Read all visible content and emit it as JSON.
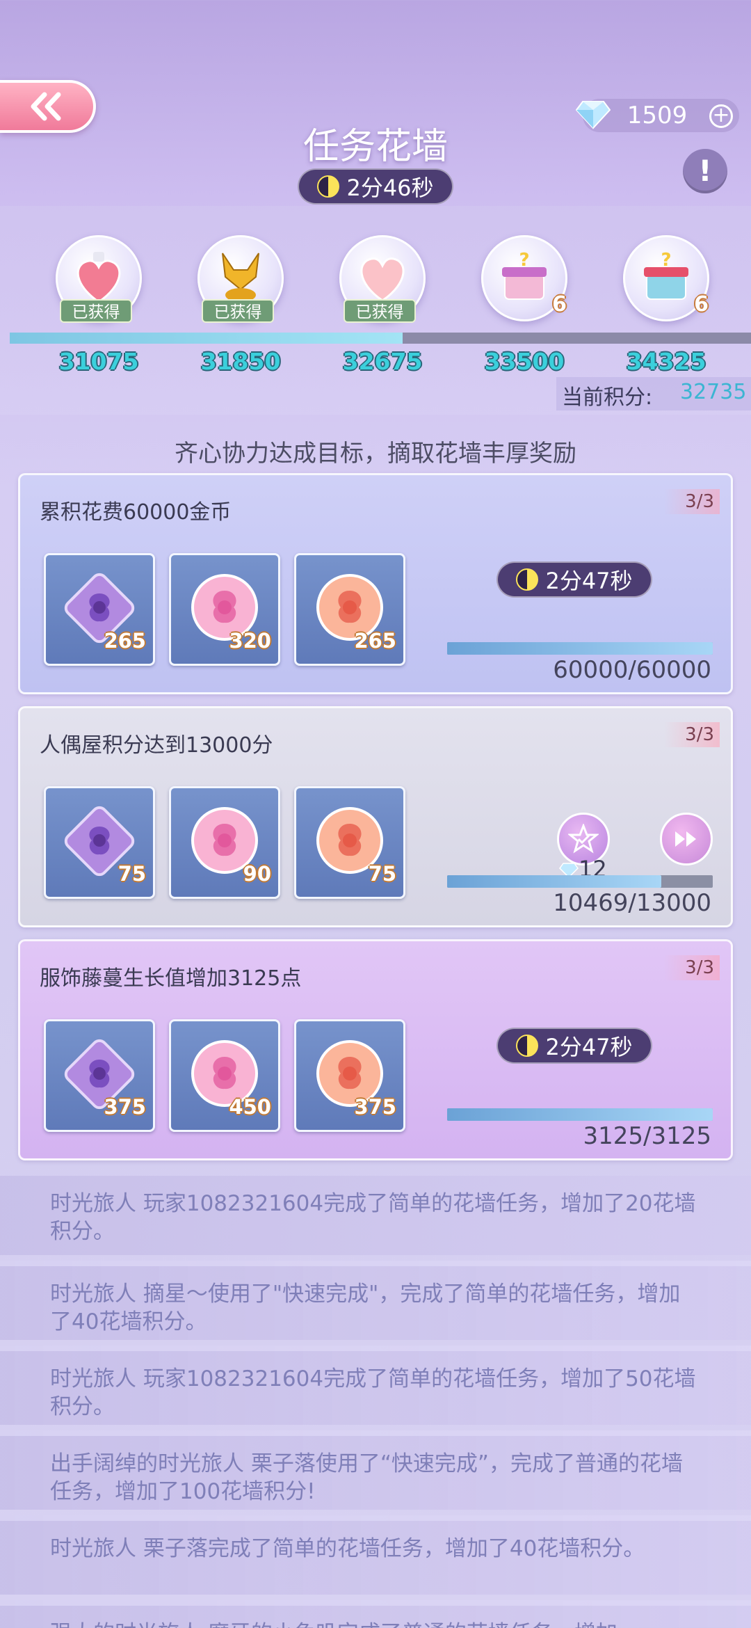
{
  "header": {
    "title": "任务花墙",
    "timer": "2分46秒",
    "gems": "1509"
  },
  "milestones": [
    {
      "score": "31075",
      "status": "已获得",
      "reward": "heart-bottle"
    },
    {
      "score": "31850",
      "status": "已获得",
      "reward": "golden-fox"
    },
    {
      "score": "32675",
      "status": "已获得",
      "reward": "pink-heart"
    },
    {
      "score": "33500",
      "status": "",
      "count": "6",
      "reward": "mystery-gift-pink"
    },
    {
      "score": "34325",
      "status": "",
      "count": "6",
      "reward": "mystery-gift-blue"
    }
  ],
  "current_score": {
    "label": "当前积分:",
    "value": "32735",
    "progress_fraction": 0.53
  },
  "subtitle": "齐心协力达成目标，摘取花墙丰厚奖励",
  "tasks": [
    {
      "title": "累积花费60000金币",
      "count": "3/3",
      "rewards": [
        "265",
        "320",
        "265"
      ],
      "timer": "2分47秒",
      "progress_text": "60000/60000",
      "progress_fraction": 1.0
    },
    {
      "title": "人偶屋积分达到13000分",
      "count": "3/3",
      "rewards": [
        "75",
        "90",
        "75"
      ],
      "cost": "12",
      "progress_text": "10469/13000",
      "progress_fraction": 0.805
    },
    {
      "title": "服饰藤蔓生长值增加3125点",
      "count": "3/3",
      "rewards": [
        "375",
        "450",
        "375"
      ],
      "timer": "2分47秒",
      "progress_text": "3125/3125",
      "progress_fraction": 1.0
    }
  ],
  "feed": [
    "时光旅人 玩家1082321604完成了简单的花墙任务，增加了20花墙积分。",
    "时光旅人 摘星～使用了\"快速完成\"，完成了简单的花墙任务，增加了40花墙积分。",
    "时光旅人 玩家1082321604完成了简单的花墙任务，增加了50花墙积分。",
    "出手阔绰的时光旅人 栗子落使用了“快速完成”，完成了普通的花墙任务，增加了100花墙积分!",
    "时光旅人 栗子落完成了简单的花墙任务，增加了40花墙积分。",
    "强大的时光旅人 磨牙的小兔叽完成了普通的花墙任务，增加"
  ],
  "colors": {
    "accent": "#4c3d72",
    "score": "#3bd0dc",
    "feed_text": "#7f7fb8"
  }
}
